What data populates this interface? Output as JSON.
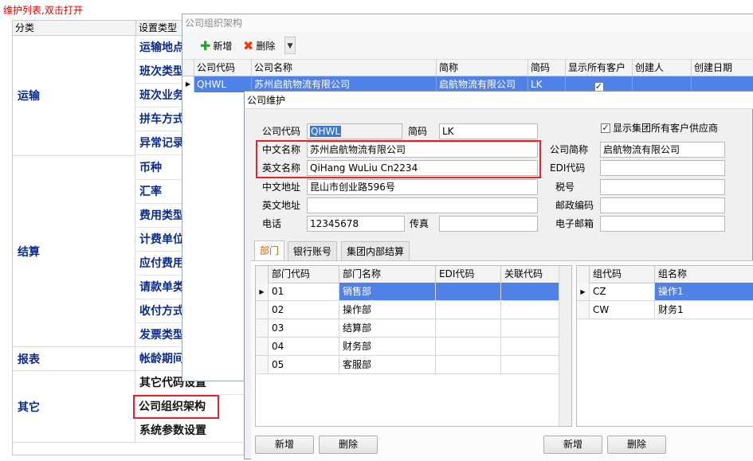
{
  "maint": {
    "hint": "维护列表,双击打开",
    "headers": {
      "category": "分类",
      "setting_type": "设置类型"
    },
    "categories": [
      "运输",
      "结算",
      "报表",
      "其它"
    ],
    "items": [
      "运输地点",
      "班次类型",
      "班次业务",
      "拼车方式",
      "异常记录",
      "币种",
      "汇率",
      "费用类型",
      "计费单位",
      "应付费用",
      "请款单类",
      "收付方式",
      "发票类型",
      "帐龄期间",
      "其它代码设置",
      "公司组织架构",
      "系统参数设置"
    ]
  },
  "org": {
    "title": "公司组织架构",
    "toolbar": {
      "add": "新增",
      "delete": "删除"
    },
    "columns": [
      "公司代码",
      "公司名称",
      "简称",
      "简码",
      "显示所有客户",
      "创建人",
      "创建日期"
    ],
    "row": {
      "code": "QHWL",
      "name": "苏州启航物流有限公司",
      "short": "启航物流有限公司",
      "abbr": "LK",
      "show_all": true,
      "creator": "",
      "created": ""
    }
  },
  "dlg": {
    "title": "公司维护",
    "labels": {
      "company_code": "公司代码",
      "abbr": "简码",
      "show_group": "显示集团所有客户供应商",
      "cn_name": "中文名称",
      "short_name": "公司简称",
      "en_name": "英文名称",
      "edi_code": "EDI代码",
      "cn_addr": "中文地址",
      "tax_no": "税号",
      "en_addr": "英文地址",
      "postcode": "邮政编码",
      "phone": "电话",
      "fax": "传真",
      "email": "电子邮箱"
    },
    "values": {
      "company_code": "QHWL",
      "abbr": "LK",
      "cn_name": "苏州启航物流有限公司",
      "short_name": "启航物流有限公司",
      "en_name": "QiHang WuLiu Cn2234",
      "edi_code": "",
      "cn_addr": "昆山市创业路596号",
      "tax_no": "",
      "en_addr": "",
      "postcode": "",
      "phone": "12345678",
      "fax": "",
      "email": ""
    },
    "show_group_checked": true,
    "tabs": [
      "部门",
      "银行账号",
      "集团内部结算"
    ],
    "dept": {
      "columns": [
        "部门代码",
        "部门名称",
        "EDI代码",
        "关联代码"
      ],
      "rows": [
        {
          "code": "01",
          "name": "销售部",
          "edi": "",
          "rel": ""
        },
        {
          "code": "02",
          "name": "操作部",
          "edi": "",
          "rel": ""
        },
        {
          "code": "03",
          "name": "结算部",
          "edi": "",
          "rel": ""
        },
        {
          "code": "04",
          "name": "财务部",
          "edi": "",
          "rel": ""
        },
        {
          "code": "05",
          "name": "客服部",
          "edi": "",
          "rel": ""
        }
      ],
      "add": "新增",
      "delete": "删除"
    },
    "group": {
      "columns": [
        "组代码",
        "组名称"
      ],
      "rows": [
        {
          "code": "CZ",
          "name": "操作1"
        },
        {
          "code": "CW",
          "name": "财务1"
        }
      ],
      "add": "新增",
      "delete": "删除"
    }
  }
}
